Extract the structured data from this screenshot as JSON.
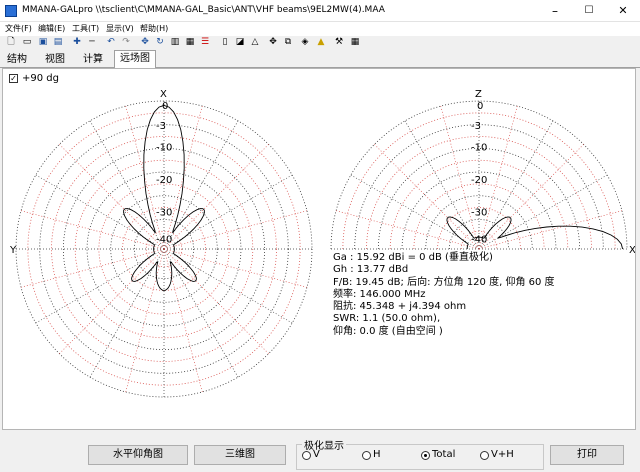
{
  "window": {
    "title": "MMANA-GALpro \\\\tsclient\\C\\MMANA-GAL_Basic\\ANT\\VHF beams\\9EL2MW(4).MAA",
    "minimize": "–",
    "maximize": "☐",
    "close": "✕"
  },
  "menu": [
    {
      "label": "文件(F)"
    },
    {
      "label": "编辑(E)"
    },
    {
      "label": "工具(T)"
    },
    {
      "label": "显示(V)"
    },
    {
      "label": "帮助(H)"
    }
  ],
  "toolbar_icons": [
    "new-icon",
    "open-icon",
    "save-icon",
    "save-as-icon",
    "add-icon",
    "remove-icon",
    "undo-icon",
    "redo-icon",
    "move-icon",
    "rotate-icon",
    "table-icon",
    "compute-icon",
    "load-icon",
    "text-icon",
    "label-icon",
    "triangle-icon",
    "circle-icon",
    "copy-icon",
    "layers-icon",
    "color-icon",
    "tools-icon",
    "grid-icon"
  ],
  "tabs": [
    {
      "label": "结构",
      "active": false
    },
    {
      "label": "视图",
      "active": false
    },
    {
      "label": "计算",
      "active": false
    },
    {
      "label": "远场图",
      "active": true
    }
  ],
  "plot": {
    "checkbox_label": "+90 dg",
    "checkbox_checked": true,
    "left": {
      "top_axis": "X",
      "left_axis": "Y",
      "ring_labels": [
        "0",
        "-3",
        "-10",
        "-20",
        "-30",
        "-40"
      ],
      "lobes_db": {
        "main": 0,
        "side_upper": -20,
        "side_lower": -24,
        "back": -30
      }
    },
    "right": {
      "top_axis": "Z",
      "right_axis": "X",
      "ring_labels": [
        "0",
        "-3",
        "-10",
        "-20",
        "-30",
        "-40"
      ]
    }
  },
  "info": {
    "ga": "Ga : 15.92 dBi = 0 dB  (垂直极化)",
    "gh": "Gh : 13.77 dBd",
    "fb": "F/B: 19.45 dB; 后向: 方位角 120 度,  仰角 60 度",
    "freq": "频率: 146.000 MHz",
    "impedance": "阻抗: 45.348 + j4.394 ohm",
    "swr": "SWR: 1.1 (50.0 ohm),",
    "elevation": "仰角: 0.0 度 (自由空间 )"
  },
  "buttons": {
    "horizontal_elevation": "水平仰角图",
    "three_d": "三维图",
    "print": "打印"
  },
  "polarization": {
    "group_label": "极化显示",
    "options": [
      {
        "label": "V",
        "selected": false
      },
      {
        "label": "H",
        "selected": false
      },
      {
        "label": "Total",
        "selected": true
      },
      {
        "label": "V+H",
        "selected": false
      }
    ]
  },
  "colors": {
    "grid_dark": "#333333",
    "grid_red": "#d9534f",
    "pattern": "#000000"
  }
}
